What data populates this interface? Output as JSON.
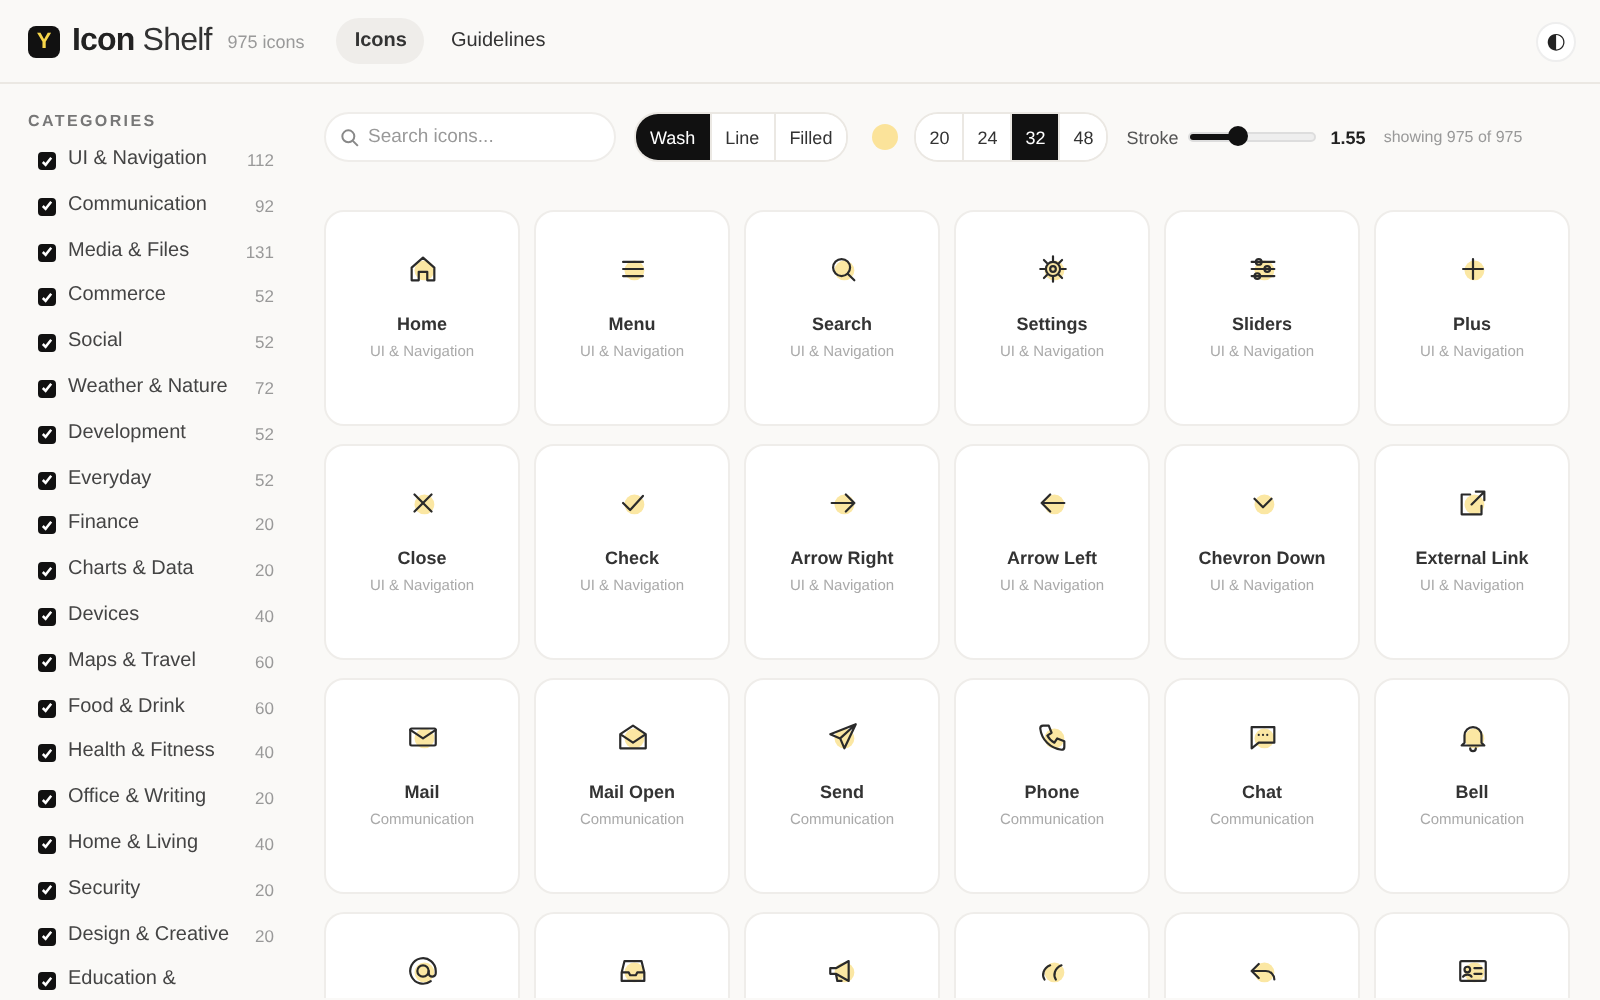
{
  "header": {
    "brand_mark": "Y",
    "brand_bold": "Icon",
    "brand_light": "Shelf",
    "icon_count": "975 icons",
    "nav": [
      {
        "label": "Icons",
        "selected": true
      },
      {
        "label": "Guidelines",
        "selected": false
      }
    ],
    "theme_toggle": "◐"
  },
  "sidebar": {
    "title": "CATEGORIES",
    "items": [
      {
        "label": "UI & Navigation",
        "count": "112",
        "checked": true
      },
      {
        "label": "Communication",
        "count": "92",
        "checked": true
      },
      {
        "label": "Media & Files",
        "count": "131",
        "checked": true
      },
      {
        "label": "Commerce",
        "count": "52",
        "checked": true
      },
      {
        "label": "Social",
        "count": "52",
        "checked": true
      },
      {
        "label": "Weather & Nature",
        "count": "72",
        "checked": true
      },
      {
        "label": "Development",
        "count": "52",
        "checked": true
      },
      {
        "label": "Everyday",
        "count": "52",
        "checked": true
      },
      {
        "label": "Finance",
        "count": "20",
        "checked": true
      },
      {
        "label": "Charts & Data",
        "count": "20",
        "checked": true
      },
      {
        "label": "Devices",
        "count": "40",
        "checked": true
      },
      {
        "label": "Maps & Travel",
        "count": "60",
        "checked": true
      },
      {
        "label": "Food & Drink",
        "count": "60",
        "checked": true
      },
      {
        "label": "Health & Fitness",
        "count": "40",
        "checked": true
      },
      {
        "label": "Office & Writing",
        "count": "20",
        "checked": true
      },
      {
        "label": "Home & Living",
        "count": "40",
        "checked": true
      },
      {
        "label": "Security",
        "count": "20",
        "checked": true
      },
      {
        "label": "Design & Creative",
        "count": "20",
        "checked": true
      },
      {
        "label": "Education &",
        "checked": true
      }
    ]
  },
  "toolbar": {
    "search": {
      "placeholder": "Search icons..."
    },
    "styles": [
      {
        "label": "Wash",
        "selected": true
      },
      {
        "label": "Line",
        "selected": false
      },
      {
        "label": "Filled",
        "selected": false
      }
    ],
    "sizes": [
      {
        "label": "20",
        "selected": false
      },
      {
        "label": "24",
        "selected": false
      },
      {
        "label": "32",
        "selected": true
      },
      {
        "label": "48",
        "selected": false
      }
    ],
    "stroke": {
      "label": "Stroke",
      "level": 0.39,
      "reading": "1.55"
    },
    "result_count": "showing 975 of 975"
  },
  "cards": [
    {
      "name": "Home",
      "category": "UI & Navigation"
    },
    {
      "name": "Menu",
      "category": "UI & Navigation"
    },
    {
      "name": "Search",
      "category": "UI & Navigation"
    },
    {
      "name": "Settings",
      "category": "UI & Navigation"
    },
    {
      "name": "Sliders",
      "category": "UI & Navigation"
    },
    {
      "name": "Plus",
      "category": "UI & Navigation"
    },
    {
      "name": "Close",
      "category": "UI & Navigation"
    },
    {
      "name": "Check",
      "category": "UI & Navigation"
    },
    {
      "name": "Arrow Right",
      "category": "UI & Navigation"
    },
    {
      "name": "Arrow Left",
      "category": "UI & Navigation"
    },
    {
      "name": "Chevron Down",
      "category": "UI & Navigation"
    },
    {
      "name": "External Link",
      "category": "UI & Navigation"
    },
    {
      "name": "Mail",
      "category": "Communication"
    },
    {
      "name": "Mail Open",
      "category": "Communication"
    },
    {
      "name": "Send",
      "category": "Communication"
    },
    {
      "name": "Phone",
      "category": "Communication"
    },
    {
      "name": "Chat",
      "category": "Communication"
    },
    {
      "name": "Bell",
      "category": "Communication"
    },
    {
      "kind": "cut"
    },
    {
      "kind": "cut"
    },
    {
      "kind": "cut"
    },
    {
      "kind": "cut"
    },
    {
      "kind": "cut"
    },
    {
      "kind": "cut"
    }
  ]
}
